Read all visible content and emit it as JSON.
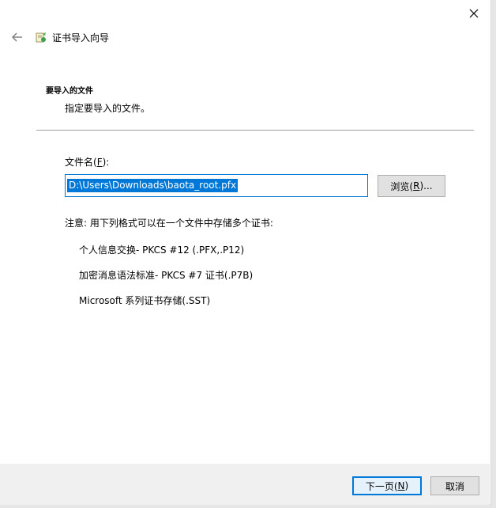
{
  "window": {
    "title": "证书导入向导"
  },
  "section": {
    "heading": "要导入的文件",
    "subtitle": "指定要导入的文件。"
  },
  "file": {
    "label_prefix": "文件名(",
    "label_key": "F",
    "label_suffix": "):",
    "value": "D:\\Users\\Downloads\\baota_root.pfx"
  },
  "browse": {
    "label_prefix": "浏览(",
    "label_key": "R",
    "label_suffix": ")..."
  },
  "note": "注意: 用下列格式可以在一个文件中存储多个证书:",
  "formats": [
    "个人信息交换- PKCS #12 (.PFX,.P12)",
    "加密消息语法标准- PKCS #7 证书(.P7B)",
    "Microsoft 系列证书存储(.SST)"
  ],
  "footer": {
    "next_prefix": "下一页(",
    "next_key": "N",
    "next_suffix": ")",
    "cancel": "取消"
  },
  "colors": {
    "accent": "#0078d7",
    "footer_bg": "#f0f0f0",
    "button_bg": "#e1e1e1"
  },
  "icons": {
    "close": "close-icon",
    "back": "back-arrow-icon",
    "wizard": "certificate-wizard-icon"
  }
}
